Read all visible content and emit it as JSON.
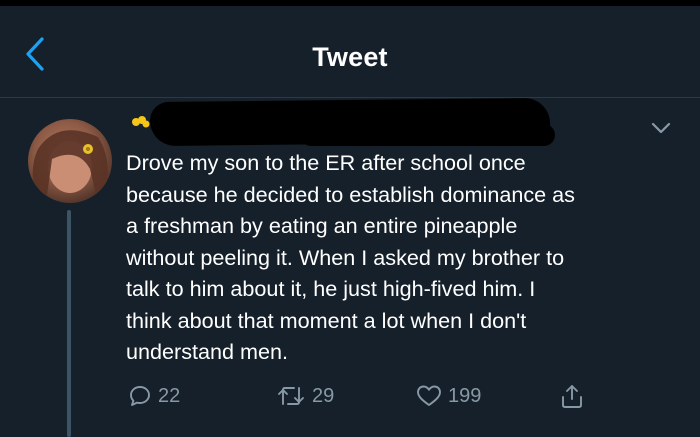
{
  "header": {
    "title": "Tweet"
  },
  "tweet": {
    "text": "Drove my son to the ER after school once\nbecause he decided to establish dominance as\na freshman by eating an entire pineapple\nwithout peeling it. When I asked my brother to\ntalk to him about it, he just high-fived him. I\nthink about that moment a lot when I don't\nunderstand men."
  },
  "actions": {
    "replies": "22",
    "retweets": "29",
    "likes": "199"
  },
  "icons": {
    "back": "chevron-left-icon",
    "menu": "chevron-down-icon",
    "reply": "speech-bubble-icon",
    "retweet": "retweet-icon",
    "like": "heart-icon",
    "share": "share-icon"
  },
  "colors": {
    "background": "#15202b",
    "accent": "#1da1f2",
    "muted": "#8899a6"
  }
}
